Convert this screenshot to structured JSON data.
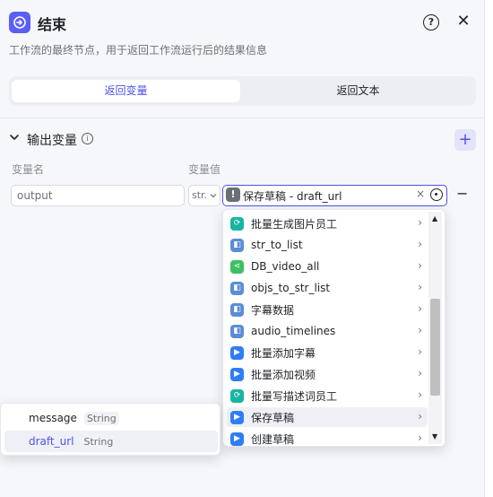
{
  "header": {
    "title": "结束",
    "description": "工作流的最终节点，用于返回工作流运行后的结果信息",
    "help_symbol": "?",
    "close_symbol": "✕"
  },
  "tabs": [
    {
      "label": "返回变量",
      "active": true
    },
    {
      "label": "返回文本",
      "active": false
    }
  ],
  "output_section": {
    "title": "输出变量",
    "info_symbol": "i",
    "add_symbol": "+",
    "col_name": "变量名",
    "col_value": "变量值",
    "rows": [
      {
        "name": "output",
        "type": "str.",
        "value_label": "保存草稿 - draft_url",
        "clear_symbol": "×",
        "remove_symbol": "−"
      }
    ]
  },
  "dropdown": {
    "items": [
      {
        "label": "批量生成图片员工",
        "icon": "loop-icon",
        "color": "#16b5a3"
      },
      {
        "label": "str_to_list",
        "icon": "code-icon",
        "color": "#5b8dd6"
      },
      {
        "label": "DB_video_all",
        "icon": "share-icon",
        "color": "#3cbf63"
      },
      {
        "label": "objs_to_str_list",
        "icon": "code-icon",
        "color": "#5b8dd6"
      },
      {
        "label": "字幕数据",
        "icon": "code-icon",
        "color": "#5b8dd6"
      },
      {
        "label": "audio_timelines",
        "icon": "code-icon",
        "color": "#5b8dd6"
      },
      {
        "label": "批量添加字幕",
        "icon": "plugin-icon",
        "color": "#2f7df6"
      },
      {
        "label": "批量添加视频",
        "icon": "plugin-icon",
        "color": "#2f7df6"
      },
      {
        "label": "批量写描述词员工",
        "icon": "loop-icon",
        "color": "#16b5a3"
      },
      {
        "label": "保存草稿",
        "icon": "plugin-icon",
        "color": "#2f7df6",
        "hover": true
      },
      {
        "label": "创建草稿",
        "icon": "plugin-icon",
        "color": "#2f7df6"
      }
    ],
    "arrow_symbol": "›",
    "scroll_up_symbol": "▲",
    "scroll_down_symbol": "▼"
  },
  "sub_popup": {
    "fields": [
      {
        "name": "message",
        "type": "String",
        "selected": false
      },
      {
        "name": "draft_url",
        "type": "String",
        "selected": true
      }
    ]
  },
  "colors": {
    "accent": "#4d53e8",
    "panel_bg": "#f6f7fb",
    "header_icon_bg": "#5b5ff6"
  }
}
